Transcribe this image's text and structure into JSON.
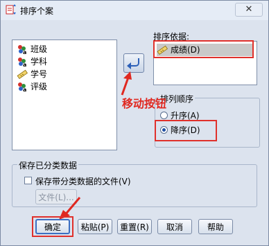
{
  "window": {
    "title": "排序个案",
    "close_glyph": "✕"
  },
  "source_list": {
    "items": [
      {
        "label": "班级",
        "icon": "nominal-variable-icon"
      },
      {
        "label": "学科",
        "icon": "nominal-variable-icon"
      },
      {
        "label": "学号",
        "icon": "scale-variable-icon"
      },
      {
        "label": "评级",
        "icon": "nominal-variable-icon"
      }
    ]
  },
  "sort_by": {
    "label": "排序依据:",
    "items": [
      {
        "label": "成绩(D)"
      }
    ]
  },
  "move_button": {
    "annotation": "移动按钮"
  },
  "sort_order": {
    "label": "排列顺序",
    "options": [
      {
        "label": "升序(A)",
        "selected": false
      },
      {
        "label": "降序(D)",
        "selected": true
      }
    ]
  },
  "save_sorted": {
    "label": "保存已分类数据",
    "checkbox_label": "保存带分类数据的文件(V)",
    "checked": false,
    "file_button": "文件(L)..."
  },
  "buttons": {
    "ok": "确定",
    "paste": "粘贴(P)",
    "reset": "重置(R)",
    "cancel": "取消",
    "help": "帮助"
  },
  "colors": {
    "highlight": "#e0302b",
    "selected_bg": "#c9c9c9"
  }
}
